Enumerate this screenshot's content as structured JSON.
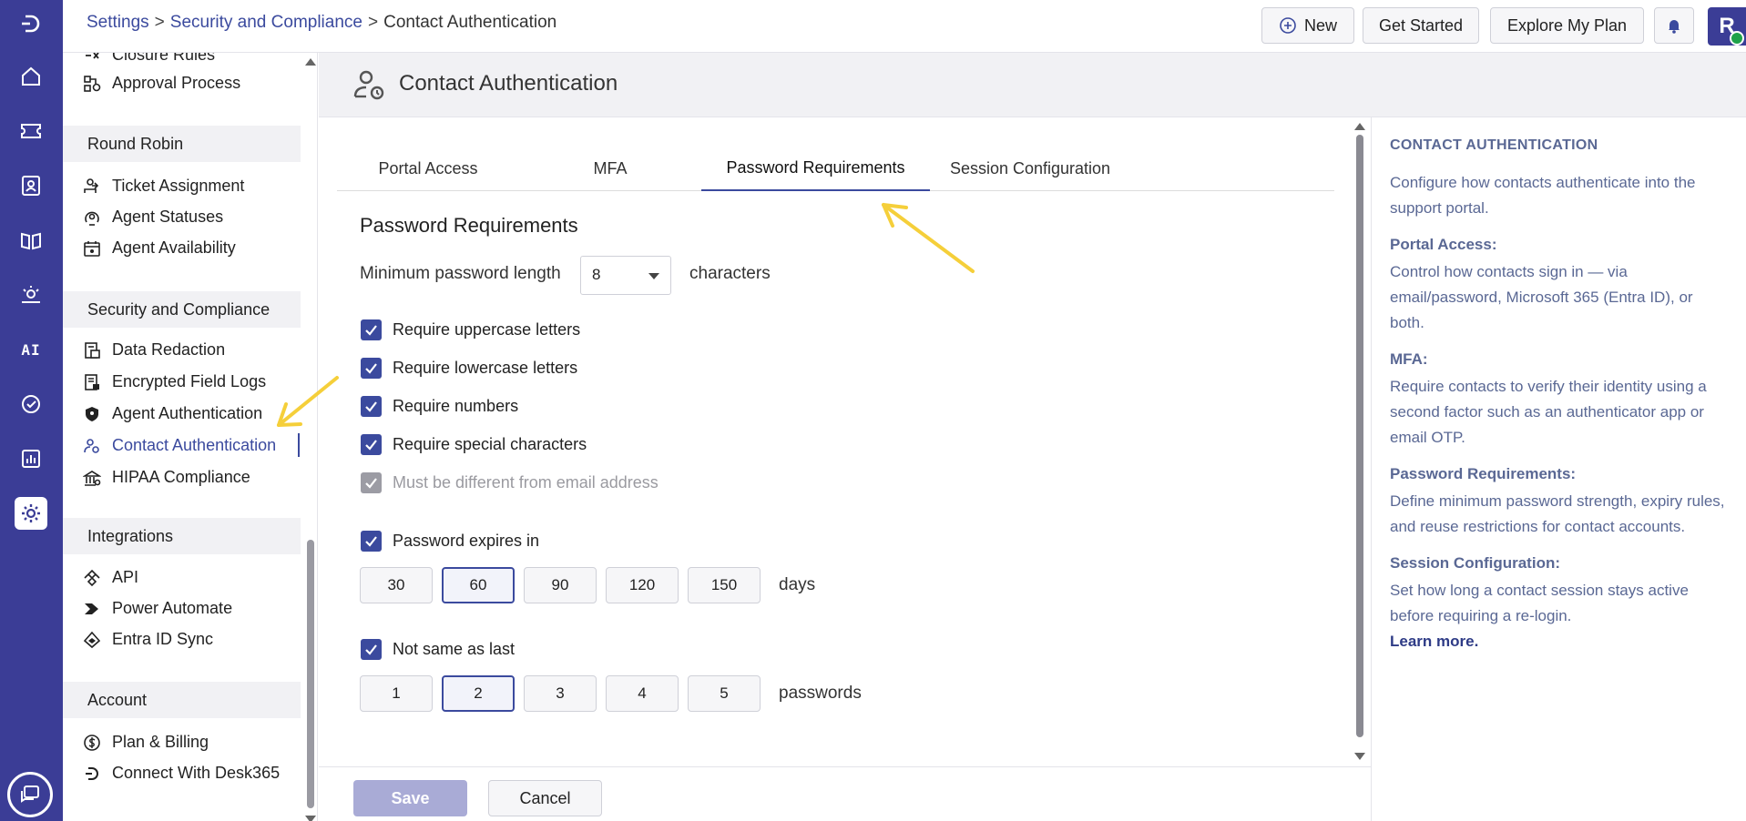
{
  "breadcrumb": {
    "items": [
      "Settings",
      "Security and Compliance",
      "Contact Authentication"
    ],
    "separator": ">"
  },
  "topbar": {
    "new_label": "New",
    "get_started_label": "Get Started",
    "explore_label": "Explore My Plan",
    "avatar_initial": "R"
  },
  "rail": {
    "ai_label": "AI",
    "icons": [
      "logo-icon",
      "home-icon",
      "ticket-icon",
      "contacts-icon",
      "knowledge-base-icon",
      "field-services-icon",
      "ai-icon",
      "tasks-icon",
      "reports-icon",
      "settings-icon",
      "chat-icon"
    ]
  },
  "sidebar": {
    "top_items": [
      {
        "label": "Closure Rules",
        "icon": "closure-rules-icon"
      },
      {
        "label": "Approval Process",
        "icon": "approval-process-icon"
      }
    ],
    "round_robin": {
      "header": "Round Robin",
      "items": [
        {
          "label": "Ticket Assignment",
          "icon": "ticket-assignment-icon"
        },
        {
          "label": "Agent Statuses",
          "icon": "agent-statuses-icon"
        },
        {
          "label": "Agent Availability",
          "icon": "agent-availability-icon"
        }
      ]
    },
    "security": {
      "header": "Security and Compliance",
      "items": [
        {
          "label": "Data Redaction",
          "icon": "data-redaction-icon"
        },
        {
          "label": "Encrypted Field Logs",
          "icon": "encrypted-logs-icon"
        },
        {
          "label": "Agent Authentication",
          "icon": "shield-icon"
        },
        {
          "label": "Contact Authentication",
          "icon": "contact-auth-icon",
          "active": true
        },
        {
          "label": "HIPAA Compliance",
          "icon": "hipaa-icon"
        }
      ]
    },
    "integrations": {
      "header": "Integrations",
      "items": [
        {
          "label": "API",
          "icon": "api-icon"
        },
        {
          "label": "Power Automate",
          "icon": "power-automate-icon"
        },
        {
          "label": "Entra ID Sync",
          "icon": "entra-id-icon"
        }
      ]
    },
    "account": {
      "header": "Account",
      "items": [
        {
          "label": "Plan & Billing",
          "icon": "billing-icon"
        },
        {
          "label": "Connect With Desk365",
          "icon": "desk365-icon"
        }
      ]
    }
  },
  "page": {
    "title": "Contact Authentication"
  },
  "tabs": [
    {
      "label": "Portal Access"
    },
    {
      "label": "MFA"
    },
    {
      "label": "Password Requirements",
      "active": true
    },
    {
      "label": "Session Configuration"
    }
  ],
  "password": {
    "section_title": "Password Requirements",
    "min_length_label": "Minimum password length",
    "min_length_value": "8",
    "min_length_unit": "characters",
    "checks": [
      {
        "label": "Require uppercase letters",
        "checked": true
      },
      {
        "label": "Require lowercase letters",
        "checked": true
      },
      {
        "label": "Require numbers",
        "checked": true
      },
      {
        "label": "Require special characters",
        "checked": true
      },
      {
        "label": "Must be different from email address",
        "checked": true,
        "disabled": true
      }
    ],
    "expires": {
      "label": "Password expires in",
      "checked": true,
      "options": [
        "30",
        "60",
        "90",
        "120",
        "150"
      ],
      "selected": "60",
      "unit": "days"
    },
    "history": {
      "label": "Not same as last",
      "checked": true,
      "options": [
        "1",
        "2",
        "3",
        "4",
        "5"
      ],
      "selected": "2",
      "unit": "passwords"
    }
  },
  "footer": {
    "save_label": "Save",
    "cancel_label": "Cancel"
  },
  "help": {
    "title": "CONTACT AUTHENTICATION",
    "intro": "Configure how contacts authenticate into the support portal.",
    "sections": [
      {
        "heading": "Portal Access:",
        "text": "Control how contacts sign in — via email/password, Microsoft 365 (Entra ID), or both."
      },
      {
        "heading": "MFA:",
        "text": "Require contacts to verify their identity using a second factor such as an authenticator app or email OTP."
      },
      {
        "heading": "Password Requirements:",
        "text": "Define minimum password strength, expiry rules, and reuse restrictions for contact accounts."
      },
      {
        "heading": "Session Configuration:",
        "text": "Set how long a contact session stays active before requiring a re-login."
      }
    ],
    "learn_more": "Learn more."
  },
  "colors": {
    "brand": "#3b3d96",
    "accent": "#3b4a9e",
    "annotation": "#f5cf3a"
  }
}
